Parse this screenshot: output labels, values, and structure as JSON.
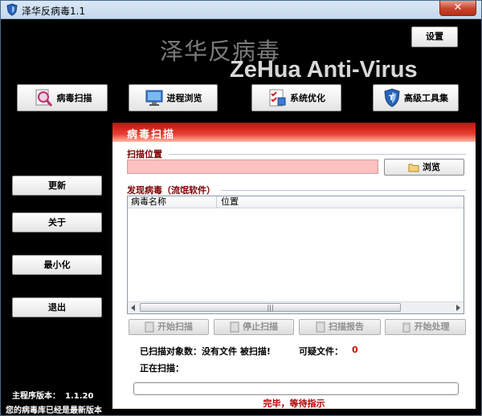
{
  "window": {
    "title": "泽华反病毒1.1",
    "close_label": "✕"
  },
  "brand": {
    "name_cn": "泽华反病毒",
    "name_en": "ZeHua Anti-Virus"
  },
  "header": {
    "settings_label": "设置"
  },
  "nav": [
    {
      "label": "病毒扫描",
      "icon": "magnifier-icon"
    },
    {
      "label": "进程浏览",
      "icon": "monitor-icon"
    },
    {
      "label": "系统优化",
      "icon": "checklist-icon"
    },
    {
      "label": "高级工具集",
      "icon": "shield-icon"
    }
  ],
  "sidebar": {
    "update": "更新",
    "about": "关于",
    "minimize": "最小化",
    "exit": "退出"
  },
  "panel": {
    "title": "病毒扫描",
    "scan_location_label": "扫描位置",
    "scan_path_value": "",
    "browse_label": "浏览",
    "found_label": "发现病毒（流氓软件）",
    "columns": [
      "病毒名称",
      "位置"
    ],
    "scroll_grip": "|||",
    "actions": {
      "start_scan": "开始扫描",
      "stop_scan": "停止扫描",
      "scan_report": "扫描报告",
      "start_process": "开始处理"
    },
    "scanned_label": "已扫描对象数：没有文件 被扫描!",
    "suspicious_label": "可疑文件：",
    "suspicious_count": "0",
    "scanning_label": "正在扫描：",
    "progress": 0,
    "status_text": "完毕，等待指示"
  },
  "footer": {
    "version_label": "主程序版本：",
    "version_value": "1.1.20",
    "db_status": "您的病毒库已经是最新版本"
  },
  "colors": {
    "header_red": "#c01010",
    "path_bg": "#ffc0c0",
    "status_red": "#b00000"
  }
}
